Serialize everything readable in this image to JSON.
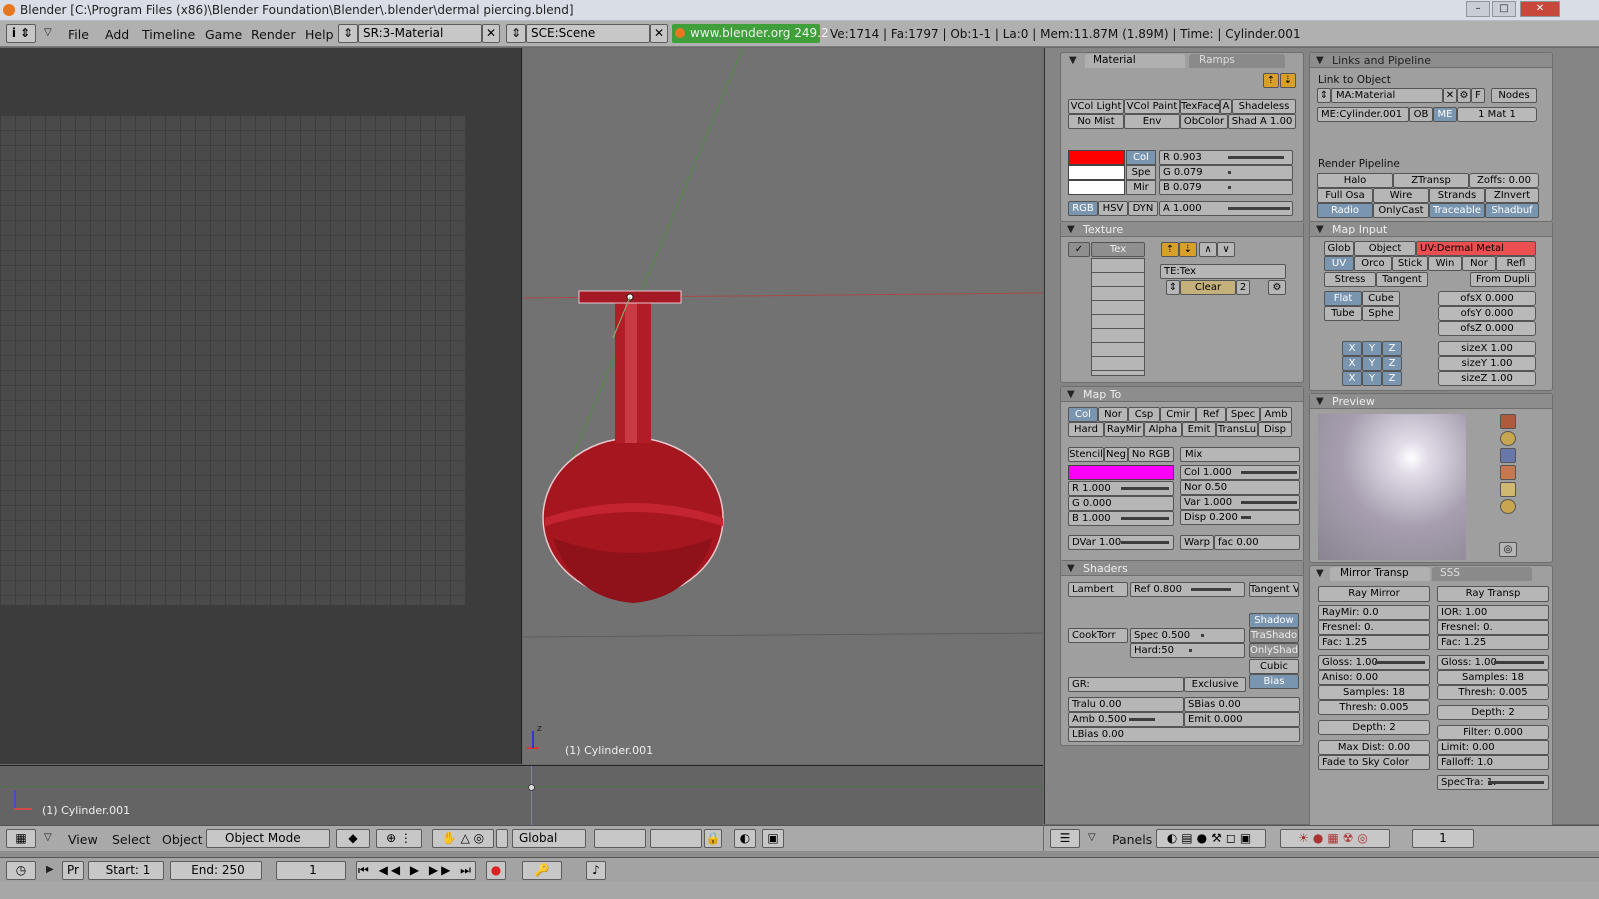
{
  "window": {
    "title": "Blender [C:\\Program Files (x86)\\Blender Foundation\\Blender\\.blender\\dermal piercing.blend]",
    "controls": {
      "minimize": "–",
      "maximize": "□",
      "close": "✕"
    }
  },
  "infobar": {
    "menus": [
      "File",
      "Add",
      "Timeline",
      "Game",
      "Render",
      "Help"
    ],
    "screen": "SR:3-Material",
    "scene": "SCE:Scene",
    "url": "www.blender.org 249.2",
    "stats": "Ve:1714 | Fa:1797 | Ob:1-1 | La:0 | Mem:11.87M (1.89M) | Time: | Cylinder.001"
  },
  "viewport": {
    "object_label": "(1) Cylinder.001",
    "timeline_label": "(1) Cylinder.001",
    "mesh_color": "#b01c26"
  },
  "header3d": {
    "menus": [
      "View",
      "Select",
      "Object"
    ],
    "mode": "Object Mode",
    "orientation": "Global"
  },
  "buttons": {
    "header": {
      "panels_label": "Panels",
      "frame": "1"
    },
    "material": {
      "tab_material": "Material",
      "tab_ramps": "Ramps",
      "row1": [
        "VCol Light",
        "VCol Paint",
        "TexFace",
        "A",
        "Shadeless"
      ],
      "row2": [
        "No Mist",
        "Env",
        "ObColor",
        "Shad A 1.00"
      ],
      "color_buttons": [
        "Col",
        "Spe",
        "Mir"
      ],
      "modes": [
        "RGB",
        "HSV",
        "DYN"
      ],
      "sliders": {
        "r": "R 0.903",
        "g": "G 0.079",
        "b": "B 0.079",
        "a": "A 1.000"
      },
      "col_color": "#ff0000"
    },
    "links": {
      "title": "Links and Pipeline",
      "link_to_object": "Link to Object",
      "material_name": "MA:Material",
      "f": "F",
      "nodes": "Nodes",
      "mesh": "ME:Cylinder.001",
      "ob": "OB",
      "me": "ME",
      "mat_index": "1 Mat 1",
      "render_pipeline": "Render Pipeline",
      "pipe_row1": [
        "Halo",
        "ZTransp",
        "Zoffs: 0.00"
      ],
      "pipe_row2": [
        "Full Osa",
        "Wire",
        "Strands",
        "ZInvert"
      ],
      "pipe_row3": [
        "Radio",
        "OnlyCast",
        "Traceable",
        "Shadbuf"
      ]
    },
    "texture": {
      "title": "Texture",
      "tex_slot": "Tex",
      "tex_name": "TE:Tex",
      "clear": "Clear",
      "users": "2"
    },
    "map_input": {
      "title": "Map Input",
      "row1": [
        "Glob",
        "Object",
        "UV:Dermal Metal"
      ],
      "row2": [
        "UV",
        "Orco",
        "Stick",
        "Win",
        "Nor",
        "Refl"
      ],
      "row3": [
        "Stress",
        "Tangent",
        "From Dupli"
      ],
      "proj1": [
        "Flat",
        "Cube"
      ],
      "proj2": [
        "Tube",
        "Sphe"
      ],
      "ofs": [
        "ofsX 0.000",
        "ofsY 0.000",
        "ofsZ 0.000"
      ],
      "size": [
        "sizeX 1.00",
        "sizeY 1.00",
        "sizeZ 1.00"
      ],
      "xyz": [
        "X",
        "Y",
        "Z"
      ]
    },
    "map_to": {
      "title": "Map To",
      "row1": [
        "Col",
        "Nor",
        "Csp",
        "Cmir",
        "Ref",
        "Spec",
        "Amb"
      ],
      "row2": [
        "Hard",
        "RayMir",
        "Alpha",
        "Emit",
        "TransLu",
        "Disp"
      ],
      "flags": [
        "Stencil",
        "Neg",
        "No RGB"
      ],
      "blend": "Mix",
      "tex_color": "#ff00ff",
      "left_sliders": [
        "R 1.000",
        "G 0.000",
        "B 1.000"
      ],
      "right_sliders": [
        "Col 1.000",
        "Nor 0.50",
        "Var 1.000",
        "Disp 0.200"
      ],
      "dvar": "DVar 1.00",
      "warp": "Warp",
      "fac": "fac 0.00"
    },
    "preview": {
      "title": "Preview"
    },
    "shaders": {
      "title": "Shaders",
      "diffuse": "Lambert",
      "ref": "Ref",
      "ref_val": "0.800",
      "tangent": "Tangent V",
      "specular": "CookTorr",
      "spec": "Spec 0.500",
      "hard": "Hard:50",
      "toggles": [
        "Shadow",
        "TraShado",
        "OnlyShad",
        "Cubic",
        "Bias"
      ],
      "gr": "GR:",
      "exclusive": "Exclusive",
      "tralu": "Tralu 0.00",
      "sbias": "SBias 0.00",
      "amb": "Amb 0.500",
      "emit": "Emit 0.000",
      "lbias": "LBias 0.00"
    },
    "mirror": {
      "tab1": "Mirror Transp",
      "tab2": "SSS",
      "ray_mirror": "Ray Mirror",
      "ray_transp": "Ray Transp",
      "left": [
        "RayMir: 0.0",
        "Fresnel: 0.",
        "Fac: 1.25"
      ],
      "right": [
        "IOR: 1.00",
        "Fresnel: 0.",
        "Fac: 1.25"
      ],
      "left2": [
        "Gloss: 1.00",
        "Aniso: 0.00",
        "Samples: 18",
        "Thresh: 0.005"
      ],
      "right2": [
        "Gloss: 1.00",
        "Samples: 18",
        "Thresh: 0.005"
      ],
      "depth_l": "Depth: 2",
      "depth_r": "Depth: 2",
      "maxdist": "Max Dist: 0.00",
      "filter": "Filter: 0.000",
      "fade": "Fade to Sky Color",
      "limit": "Limit: 0.00",
      "falloff": "Falloff: 1.0",
      "spectra": "SpecTra: 1."
    }
  },
  "bottombar": {
    "pr": "Pr",
    "start": "Start: 1",
    "end": "End: 250",
    "frame": "1"
  }
}
